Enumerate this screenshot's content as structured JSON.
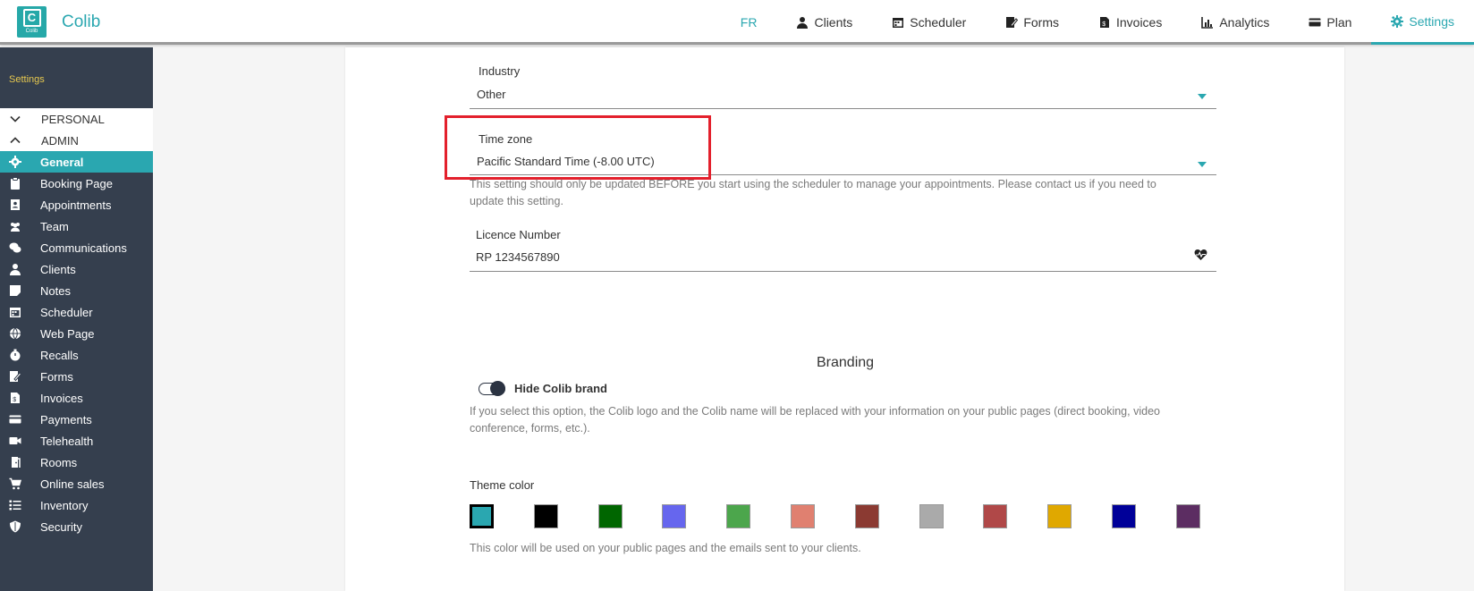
{
  "app": {
    "brand": "Colib",
    "logo_letter": "C",
    "logo_small": "Colib"
  },
  "nav": {
    "lang": "FR",
    "items": [
      {
        "label": "Clients",
        "icon": "user-icon"
      },
      {
        "label": "Scheduler",
        "icon": "calendar-icon"
      },
      {
        "label": "Forms",
        "icon": "signature-icon"
      },
      {
        "label": "Invoices",
        "icon": "invoice-icon"
      },
      {
        "label": "Analytics",
        "icon": "chart-icon"
      },
      {
        "label": "Plan",
        "icon": "credit-card-icon"
      },
      {
        "label": "Settings",
        "icon": "gear-icon",
        "active": true
      }
    ]
  },
  "sidebar": {
    "title": "Settings",
    "groups": {
      "personal": "PERSONAL",
      "admin": "ADMIN"
    },
    "items": [
      {
        "label": "General",
        "icon": "gear-icon",
        "active": true
      },
      {
        "label": "Booking Page",
        "icon": "clipboard-icon"
      },
      {
        "label": "Appointments",
        "icon": "contact-book-icon"
      },
      {
        "label": "Team",
        "icon": "users-icon"
      },
      {
        "label": "Communications",
        "icon": "comments-icon"
      },
      {
        "label": "Clients",
        "icon": "user-icon"
      },
      {
        "label": "Notes",
        "icon": "sticky-note-icon"
      },
      {
        "label": "Scheduler",
        "icon": "calendar-icon"
      },
      {
        "label": "Web Page",
        "icon": "globe-icon"
      },
      {
        "label": "Recalls",
        "icon": "stopwatch-icon"
      },
      {
        "label": "Forms",
        "icon": "signature-icon"
      },
      {
        "label": "Invoices",
        "icon": "invoice-icon"
      },
      {
        "label": "Payments",
        "icon": "credit-card-icon"
      },
      {
        "label": "Telehealth",
        "icon": "video-icon"
      },
      {
        "label": "Rooms",
        "icon": "door-icon"
      },
      {
        "label": "Online sales",
        "icon": "cart-icon"
      },
      {
        "label": "Inventory",
        "icon": "list-icon"
      },
      {
        "label": "Security",
        "icon": "shield-icon"
      }
    ]
  },
  "form": {
    "industry": {
      "label": "Industry",
      "value": "Other"
    },
    "timezone": {
      "label": "Time zone",
      "value": "Pacific Standard Time (-8.00 UTC)",
      "helper_line1": "This setting should only be updated BEFORE you start using the scheduler to manage your appointments. Please contact us if you need to",
      "helper_line2": "update this setting."
    },
    "licence": {
      "label": "Licence Number",
      "value": "RP 1234567890"
    }
  },
  "branding": {
    "title": "Branding",
    "hide_brand_label": "Hide Colib brand",
    "hide_brand_on": true,
    "hide_brand_help_line1": "If you select this option, the Colib logo and the Colib name will be replaced with your information on your public pages (direct booking, video",
    "hide_brand_help_line2": "conference, forms, etc.).",
    "theme_label": "Theme color",
    "theme_help": "This color will be used on your public pages and the emails sent to your clients.",
    "selected_index": 0,
    "colors": [
      "#2aa7b0",
      "#000000",
      "#006600",
      "#6666ee",
      "#4ca64c",
      "#e08070",
      "#8b3a32",
      "#aaaaaa",
      "#b04848",
      "#e0a800",
      "#000099",
      "#5c2d62"
    ]
  },
  "colors": {
    "accent": "#2aa7b0",
    "sidebar_bg": "#353f4e",
    "highlight": "#e3202c"
  }
}
